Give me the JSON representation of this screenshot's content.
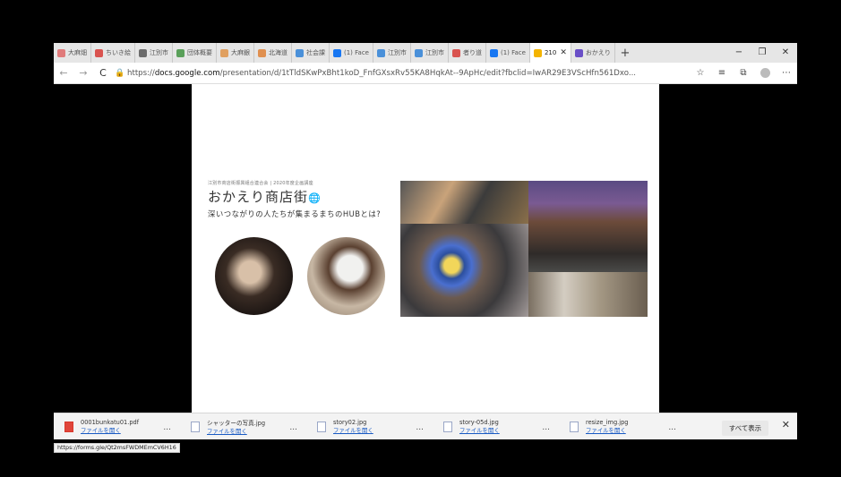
{
  "tabs": [
    {
      "label": "大麻畑",
      "color": "#e07b7b"
    },
    {
      "label": "ちいき絵",
      "color": "#d9534f"
    },
    {
      "label": "江別市",
      "color": "#6c6c6c"
    },
    {
      "label": "団体概要",
      "color": "#5aa05a"
    },
    {
      "label": "大麻銀",
      "color": "#e0a060"
    },
    {
      "label": "北海道",
      "color": "#e09050"
    },
    {
      "label": "社会課",
      "color": "#4a90d9"
    },
    {
      "label": "(1) Face",
      "color": "#1877f2"
    },
    {
      "label": "江別市",
      "color": "#4a90d9"
    },
    {
      "label": "江別市",
      "color": "#4a90d9"
    },
    {
      "label": "者り道",
      "color": "#d9534f"
    },
    {
      "label": "(1) Face",
      "color": "#1877f2"
    },
    {
      "label": "210",
      "color": "#f4b400",
      "active": true
    },
    {
      "label": "おかえり",
      "color": "#6a4fc7"
    }
  ],
  "window_controls": {
    "minimize": "−",
    "restore": "❐",
    "close": "✕"
  },
  "nav": {
    "back": "←",
    "forward": "→",
    "reload": "C",
    "url_prefix": "https://",
    "url_host": "docs.google.com",
    "url_rest": "/presentation/d/1tTldSKwPxBht1koD_FnfGXsxRv55KA8HqkAt--9ApHc/edit?fbclid=IwAR29E3VScHfn561Dxo..."
  },
  "slide": {
    "eyebrow": "江別市商店街振興組合連合会 | 2020年度企画講座",
    "title": "おかえり商店街",
    "title_icon": "🌐",
    "subtitle": "深いつながりの人たちが集まるまちのHUBとは?"
  },
  "status_link": "https://forms.gle/Qt2msFWDMEmCV6H16",
  "downloads": {
    "open_label": "ファイルを開く",
    "more": "...",
    "items": [
      {
        "file": "0001bunkatu01.pdf",
        "type": "pdf"
      },
      {
        "file": "シャッターの写真.jpg",
        "type": "jpg"
      },
      {
        "file": "story02.jpg",
        "type": "jpg"
      },
      {
        "file": "story-05d.jpg",
        "type": "jpg"
      },
      {
        "file": "resize_img.jpg",
        "type": "jpg"
      }
    ],
    "show_all": "すべて表示",
    "close": "✕"
  }
}
